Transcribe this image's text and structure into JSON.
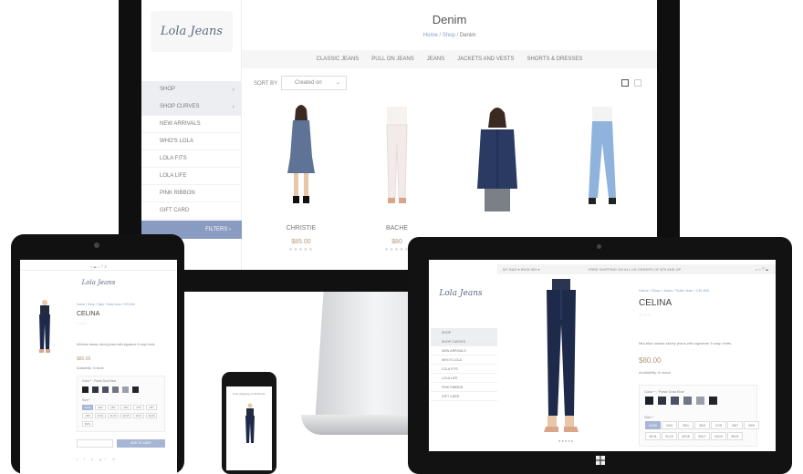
{
  "desktop": {
    "logo": "Lola Jeans",
    "sidebar": [
      {
        "label": "SHOP",
        "chev": "›",
        "grey": true
      },
      {
        "label": "SHOP CURVES",
        "chev": "›",
        "grey": true
      },
      {
        "label": "NEW ARRIVALS"
      },
      {
        "label": "WHO'S LOLA"
      },
      {
        "label": "LOLA FITS"
      },
      {
        "label": "LOLA LIFE"
      },
      {
        "label": "PINK RIBBON"
      },
      {
        "label": "GIFT CARD"
      }
    ],
    "filters_label": "FILTERS ›",
    "page_title": "Denim",
    "breadcrumb": {
      "home": "Home",
      "sep": "/",
      "shop": "Shop",
      "current": "Denim"
    },
    "categories": [
      "CLASSIC JEANS",
      "PULL ON JEANS",
      "JEANS",
      "JACKETS AND VESTS",
      "SHORTS & DRESSES"
    ],
    "sort_label": "SORT BY",
    "sort_value": "Created on",
    "products": [
      {
        "name": "CHRISTIE",
        "price": "$85.00",
        "stars": "★★★★★",
        "outfit": "denim-dress",
        "top": "#5f7397",
        "bottom": "#5f7397"
      },
      {
        "name": "BACHE",
        "price": "$80",
        "stars": "★★★★★",
        "outfit": "white-jeans",
        "top": "#f6f2f0",
        "bottom": "#f3eaea"
      },
      {
        "name": "",
        "price": "",
        "stars": "",
        "outfit": "denim-jacket",
        "top": "#2a3a63",
        "bottom": "#7b7f86"
      },
      {
        "name": "",
        "price": "",
        "stars": "",
        "outfit": "light-jeans",
        "top": "#f3f3f3",
        "bottom": "#8fb3dd"
      }
    ]
  },
  "ipad": {
    "topbar": "⌕ ☰ ⌂ ♡ ⌗",
    "logo": "Lola Jeans",
    "breadcrumb": "Home / Shop / Style / Solid Jean / CELINA",
    "product_name": "CELINA",
    "stars": "☆☆☆",
    "description": "Mid blue classic skinny jeans with signature 5 snap rivets",
    "price": "$80.00",
    "availability": "Availability: In stock",
    "color_label": "Color * : Poise Dust Blue",
    "size_label": "Size *",
    "sizes": [
      "22/00",
      "24/0",
      "25/1",
      "26/3",
      "27/5",
      "28/7",
      "29/9",
      "30/11",
      "31/13",
      "32/15",
      "33/17",
      "34/19",
      "35/21"
    ],
    "add_to_cart": "ADD TO CART",
    "social": "f t p g+ ✉"
  },
  "iphone": {
    "title": "Free shipping on all Denim"
  },
  "tablet": {
    "topbar_left": "MY BAG  ▾   ENGLISH  ▾",
    "topbar_center": "FREE SHIPPING ON ALL US ORDERS OF $75 AND UP",
    "topbar_right": "⌕  ⌂  ♡  ☰",
    "logo": "Lola Jeans",
    "nav": [
      {
        "label": "SHOP",
        "grey": true
      },
      {
        "label": "SHOP CURVES",
        "grey": true
      },
      {
        "label": "NEW ARRIVALS"
      },
      {
        "label": "WHO'S LOLA"
      },
      {
        "label": "LOLA FITS"
      },
      {
        "label": "LOLA LIFE"
      },
      {
        "label": "PINK RIBBON"
      },
      {
        "label": "GIFT CARD"
      }
    ],
    "breadcrumb": "Home / Shop / Jeans / Solid Jean / CELINA",
    "product_name": "CELINA",
    "stars": "☆☆☆",
    "description": "Mid-blue classic skinny jeans with signature 5 snap rivets.",
    "price": "$80.00",
    "availability": "Availability: In stock",
    "color_label": "Color * : Poise Dust Blue",
    "size_label": "Size *",
    "sizes": [
      "22/00",
      "24/0",
      "25/1",
      "26/3",
      "27/5",
      "28/7",
      "29/9",
      "30/11",
      "31/13",
      "32/15",
      "33/17",
      "34/19",
      "35/21"
    ],
    "gallery_dots": "●●●●●"
  },
  "colors": {
    "swatches": [
      "#1d1f26",
      "#2e3442",
      "#4b5263",
      "#6f7683",
      "#9aa0aa",
      "#23252b"
    ]
  }
}
